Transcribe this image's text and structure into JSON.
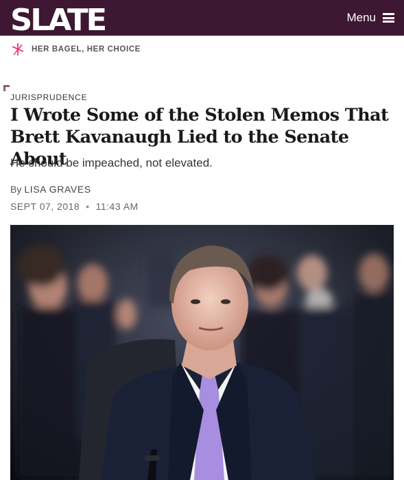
{
  "header": {
    "logo_text": "SLATE",
    "menu_label": "Menu",
    "background_color": "#3e1732"
  },
  "promo": {
    "icon": "pinwheel-logo-icon",
    "text": "HER BAGEL, HER CHOICE",
    "accent_color": "#e8256e"
  },
  "article": {
    "kicker": "JURISPRUDENCE",
    "headline": "I Wrote Some of the Stolen Memos That Brett Kavanaugh Lied to the Senate About",
    "dek": "He should be impeached, not elevated.",
    "byline_prefix": "By",
    "author": "LISA GRAVES",
    "date": "SEPT 07, 2018",
    "separator": "•",
    "time": "11:43 AM"
  },
  "hero_image": {
    "icon": "photo-icon"
  }
}
